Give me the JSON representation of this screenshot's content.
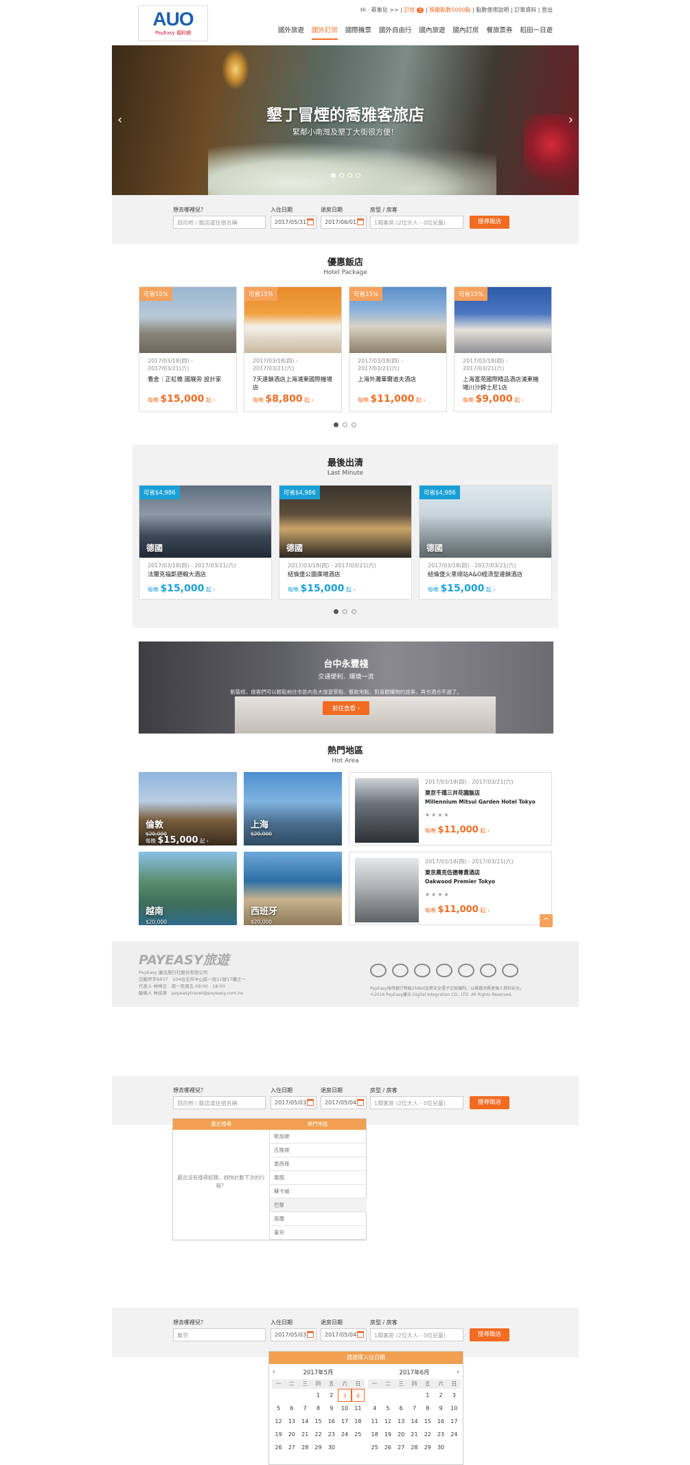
{
  "header": {
    "logo": "AUO",
    "logo_sub": "PayEasy 福利網",
    "greeting": "Hi · 蔡東岳 >>",
    "cart_label": "訂房",
    "cart_count": "2",
    "points": "獎勵點數5000點",
    "links": [
      "點數使用說明",
      "訂單資料",
      "登出"
    ],
    "nav": [
      "國外旅遊",
      "國外訂房",
      "國際機票",
      "國外自由行",
      "國內旅遊",
      "國內訂房",
      "餐旅票券",
      "稻田一日遊"
    ],
    "active_nav": "國外訂房"
  },
  "hero": {
    "title": "墾丁冒煙的喬雅客旅店",
    "subtitle": "緊鄰小南灣及墾丁大街很方便！",
    "prev": "‹",
    "next": "›"
  },
  "search1": {
    "where_label": "想去哪裡兒？",
    "where_placeholder": "目的地 / 飯店或住宿名稱",
    "checkin_label": "入住日期",
    "checkin": "2017/05/31",
    "checkout_label": "退房日期",
    "checkout": "2017/06/01",
    "room_label": "房型 / 房客",
    "room": "1間客房 (2位大人 - 0位兒童)",
    "button": "搜尋飯店"
  },
  "hotel_package": {
    "title": "優惠飯店",
    "subtitle": "Hotel Package",
    "cards": [
      {
        "tag": "可省15%",
        "date": "2017/03/18(四) - 2017/03/21(六)",
        "name": "養舍｜正虹橋 國展旁 設計家",
        "per": "每晚",
        "price": "$15,000",
        "suffix": "起 ›"
      },
      {
        "tag": "可省15%",
        "date": "2017/03/18(四) - 2017/03/21(六)",
        "name": "7天連鎖酒店上海浦東國際機場店",
        "per": "每晚",
        "price": "$8,800",
        "suffix": "起 ›"
      },
      {
        "tag": "可省15%",
        "date": "2017/03/18(四) - 2017/03/21(六)",
        "name": "上海外灘華爾道夫酒店",
        "per": "每晚",
        "price": "$11,000",
        "suffix": "起 ›"
      },
      {
        "tag": "可省15%",
        "date": "2017/03/18(四) - 2017/03/21(六)",
        "name": "上海富苑國際精品酒店浦東機場川沙錦士尼1店",
        "per": "每晚",
        "price": "$9,000",
        "suffix": "起 ›"
      }
    ]
  },
  "last_minute": {
    "title": "最後出清",
    "subtitle": "Last Minute",
    "cards": [
      {
        "tag": "可省$4,986",
        "country": "德國",
        "date": "2017/03/18(四) - 2017/03/21(六)",
        "name": "法蘭克福凱德翰大酒店",
        "per": "每晚",
        "price": "$15,000",
        "suffix": "起 ›"
      },
      {
        "tag": "可省$4,986",
        "country": "德國",
        "date": "2017/03/18(四) - 2017/03/21(六)",
        "name": "紐倫堡公園廣場酒店",
        "per": "每晚",
        "price": "$15,000",
        "suffix": "起 ›"
      },
      {
        "tag": "可省$4,986",
        "country": "德國",
        "date": "2017/03/18(四) - 2017/03/21(六)",
        "name": "紐倫堡火車總站A&O經濟型連鎖酒店",
        "per": "每晚",
        "price": "$15,000",
        "suffix": "起 ›"
      }
    ]
  },
  "banner": {
    "title": "台中永豐棧",
    "subtitle": "交通便利．環境一流",
    "desc": "新裝修，旅客們可以輕鬆前往市區內各大旅遊景點、餐飲地點、對喜歡購物的旅客，再也適合不過了。",
    "button": "前往查看 ›"
  },
  "hot_area": {
    "title": "熱門地區",
    "subtitle": "Hot Area",
    "areas": [
      {
        "name": "倫敦",
        "old": "$20,000",
        "per": "每晚",
        "price": "$15,000",
        "suffix": "起 ›"
      },
      {
        "name": "上海",
        "old": "$20,000"
      },
      {
        "name": "越南",
        "old": "$20,000"
      },
      {
        "name": "西班牙",
        "old": "$20,000"
      }
    ],
    "hotels": [
      {
        "date": "2017/03/18(四) - 2017/03/21(六)",
        "name": "東京千禧三井花園飯店",
        "en": "Millennium Mitsui Garden Hotel Tokyo",
        "stars": "★★★★",
        "per": "每晚",
        "price": "$11,000",
        "suffix": "起 ›"
      },
      {
        "date": "2017/03/18(四) - 2017/03/21(六)",
        "name": "東京奧克伍德尊貴酒店",
        "en": "Oakwood Premier Tokyo",
        "stars": "★★★★",
        "per": "每晚",
        "price": "$11,000",
        "suffix": "起 ›"
      }
    ]
  },
  "footer": {
    "logo": "PAYEASY旅遊",
    "company": "PayEasy 康迅旅行社股份有限公司",
    "line1": "交觀甲字6837　104台北市中山區一段11號17樓之一",
    "line2": "代表人 林坤正　周一至周五 09:00 - 18:00",
    "line3": "聯絡人 林佳燕　payeasytravel@payeasy.com.tw",
    "copy1": "PayEasy採用銀行等級256bit加密安全電子交易機制，以維護消費者個人資料安全。",
    "copy2": "©2016 PayEasy康迅 Digital Integration CO., LTD. All Rights Reserved."
  },
  "search2": {
    "where_label": "想去哪裡兒？",
    "where_placeholder": "目的地 / 飯店或住宿名稱",
    "checkin_label": "入住日期",
    "checkin": "2017/05/03",
    "checkout_label": "退房日期",
    "checkout": "2017/05/04",
    "room_label": "房型 / 房客",
    "room": "1間客房 (2位大人 - 0位兒童)",
    "button": "搜尋飯店",
    "dropdown": {
      "tab_recent": "最近搜尋",
      "tab_hot": "熱門地區",
      "empty": "最近沒有搜尋紀錄，趕快計劃下次的行程？",
      "items": [
        "新加坡",
        "吉隆坡",
        "墨西哥",
        "泰國",
        "蘇卡威",
        "巴黎",
        "首爾",
        "東京"
      ],
      "highlight": "巴黎"
    }
  },
  "search3": {
    "where_label": "想去哪裡兒？",
    "where_value": "東京",
    "checkin_label": "入住日期",
    "checkin": "2017/05/03",
    "checkout_label": "退房日期",
    "checkout": "2017/05/04",
    "room_label": "房型 / 房客",
    "room": "1間客房 (2位大人 - 0位兒童)",
    "button": "搜尋飯店",
    "calendar": {
      "header": "請選擇入住日期",
      "weekdays": [
        "一",
        "二",
        "三",
        "四",
        "五",
        "六",
        "日"
      ],
      "months": [
        {
          "title": "2017年5月",
          "days": [
            "",
            "",
            "",
            "1",
            "2",
            "3",
            "4",
            "5",
            "6",
            "7",
            "8",
            "9",
            "10",
            "11",
            "12",
            "13",
            "14",
            "15",
            "16",
            "17",
            "18",
            "19",
            "20",
            "21",
            "22",
            "23",
            "24",
            "25",
            "26",
            "27",
            "28",
            "29",
            "30",
            "",
            ""
          ],
          "selected": [
            "3",
            "4"
          ]
        },
        {
          "title": "2017年6月",
          "days": [
            "",
            "",
            "",
            "",
            "1",
            "2",
            "3",
            "4",
            "5",
            "6",
            "7",
            "8",
            "9",
            "10",
            "11",
            "12",
            "13",
            "14",
            "15",
            "16",
            "17",
            "18",
            "19",
            "20",
            "21",
            "22",
            "23",
            "24",
            "25",
            "26",
            "27",
            "28",
            "29",
            "30",
            ""
          ],
          "selected": []
        }
      ]
    }
  },
  "colors": {
    "accent": "#f26b21",
    "blue_tag": "#1aa0d6",
    "orange_tag": "#f6a15c"
  }
}
